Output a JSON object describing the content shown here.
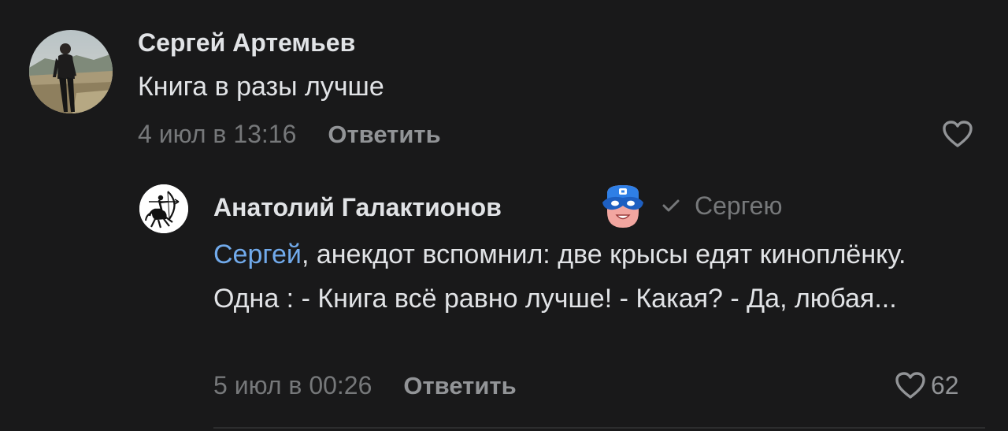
{
  "comments": [
    {
      "author": "Сергей Артемьев",
      "text": "Книга в разы лучше",
      "timestamp": "4 июл в 13:16",
      "reply_label": "Ответить",
      "avatar_icon": "user-photo",
      "like_icon": "heart-icon"
    }
  ],
  "reply": {
    "author": "Анатолий Галактионов",
    "badge_icon": "superhero-mask-badge",
    "reply_to_icon": "checkmark-icon",
    "reply_to": "Сергею",
    "mention": "Сергей",
    "text": ", анекдот вспомнил: две крысы едят киноплёнку. Одна : - Книга всё равно лучше!  - Какая?  - Да, любая...",
    "timestamp": "5 июл в 00:26",
    "reply_label": "Ответить",
    "likes": "62",
    "avatar_icon": "archer-centaur-logo",
    "like_icon": "heart-icon"
  },
  "colors": {
    "background": "#19191a",
    "text": "#e1e3e6",
    "secondary": "#76787a",
    "mention": "#71aaeb"
  }
}
